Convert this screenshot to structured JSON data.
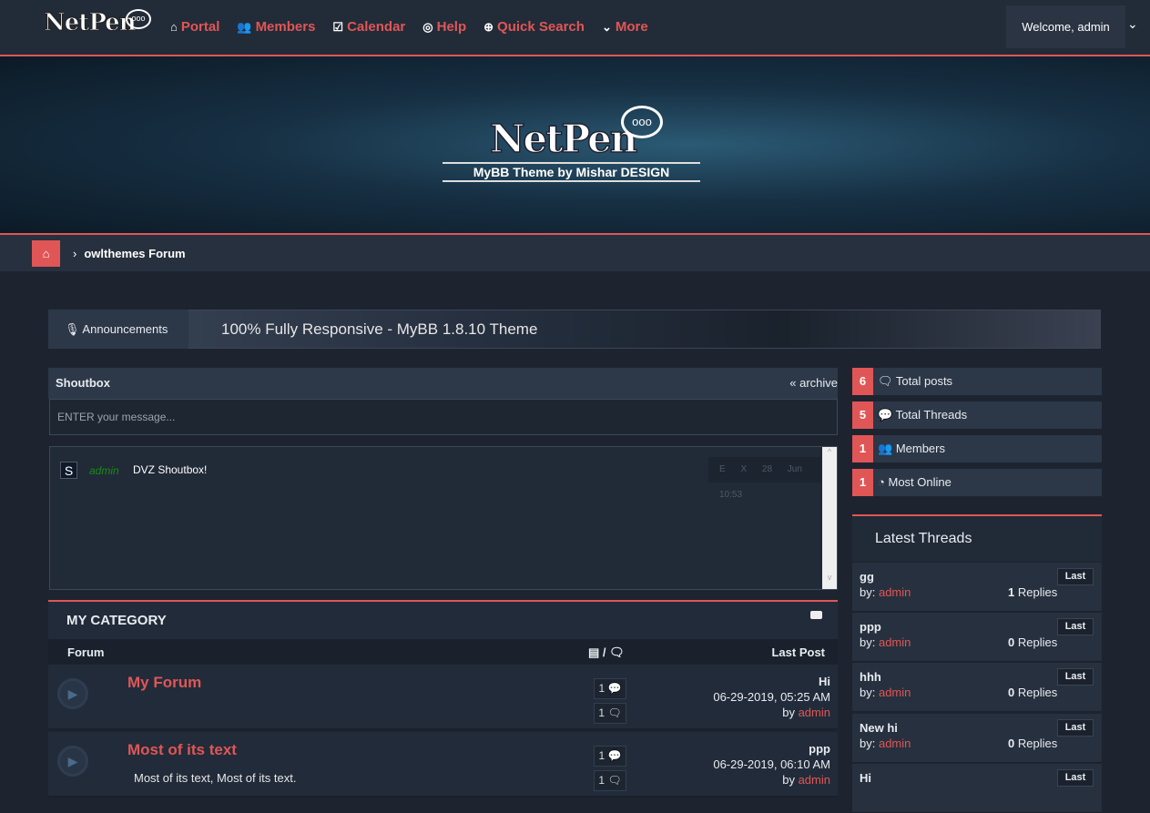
{
  "header": {
    "logo": "NetPen",
    "logo_bubble": "ooo",
    "nav": [
      {
        "icon": "⌂",
        "label": "Portal"
      },
      {
        "icon": "👥",
        "label": "Members"
      },
      {
        "icon": "☑",
        "label": "Calendar"
      },
      {
        "icon": "◎",
        "label": "Help"
      },
      {
        "icon": "⊕",
        "label": "Quick Search"
      },
      {
        "icon": "⌄",
        "label": "More"
      }
    ],
    "welcome": "Welcome, admin"
  },
  "banner": {
    "logo": "NetPen",
    "bubble": "ooo",
    "tagline": "MyBB Theme by Mishar DESIGN"
  },
  "breadcrumb": {
    "current": "owlthemes Forum"
  },
  "announcement": {
    "label": "Announcements",
    "text": "100% Fully Responsive - MyBB 1.8.10 Theme"
  },
  "shoutbox": {
    "title": "Shoutbox",
    "archive": "« archive",
    "placeholder": "ENTER your message...",
    "messages": [
      {
        "avatar": "S",
        "user": "admin",
        "text": "DVZ Shoutbox!",
        "actions": "E X",
        "time": "28 Jun 10:53"
      }
    ]
  },
  "category": {
    "title": "MY CATEGORY",
    "col_forum": "Forum",
    "col_counts": "/",
    "col_last": "Last Post",
    "forums": [
      {
        "title": "My Forum",
        "desc": "",
        "threads": "1",
        "posts": "1",
        "last_title": "Hi",
        "last_date": "06-29-2019, 05:25 AM",
        "last_by": "by",
        "last_user": "admin"
      },
      {
        "title": "Most of its text",
        "desc": "Most of its text, Most of its text.",
        "threads": "1",
        "posts": "1",
        "last_title": "ppp",
        "last_date": "06-29-2019, 06:10 AM",
        "last_by": "by",
        "last_user": "admin"
      }
    ]
  },
  "stats": [
    {
      "n": "6",
      "icon": "🗨",
      "label": "Total posts"
    },
    {
      "n": "5",
      "icon": "💬",
      "label": "Total Threads"
    },
    {
      "n": "1",
      "icon": "👥",
      "label": "Members"
    },
    {
      "n": "1",
      "icon": "◔",
      "label": "Most Online"
    }
  ],
  "latest": {
    "title": "Latest Threads",
    "by": "by:",
    "last": "Last",
    "replies_label": "Replies",
    "threads": [
      {
        "title": "gg",
        "user": "admin",
        "replies": "1"
      },
      {
        "title": "ppp",
        "user": "admin",
        "replies": "0"
      },
      {
        "title": "hhh",
        "user": "admin",
        "replies": "0"
      },
      {
        "title": "New hi",
        "user": "admin",
        "replies": "0"
      },
      {
        "title": "Hi",
        "user": "",
        "replies": ""
      }
    ]
  },
  "colors": {
    "accent": "#e05656",
    "header": "#222b38",
    "body": "#1d2430"
  }
}
